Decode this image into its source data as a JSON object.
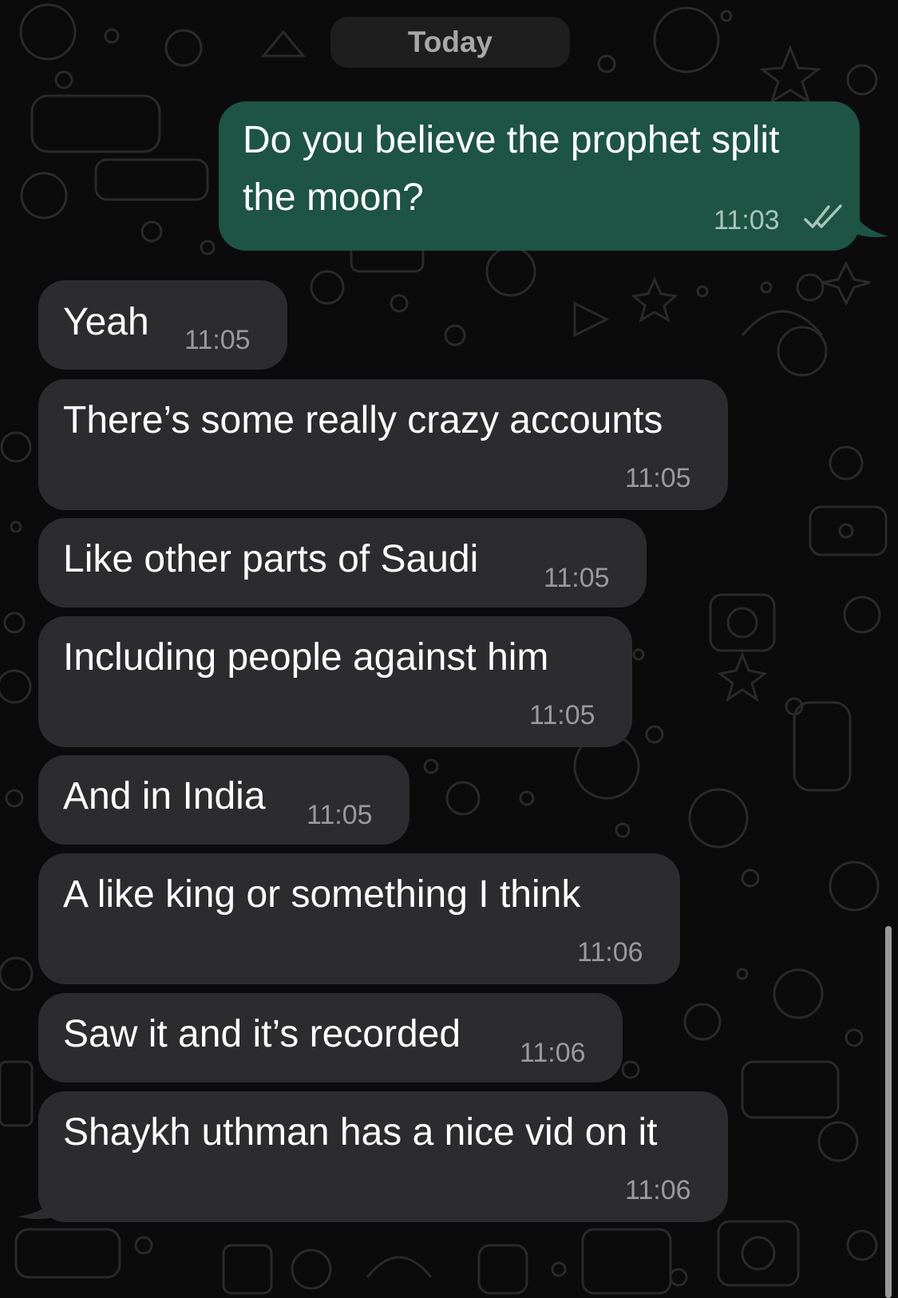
{
  "chat": {
    "date_header": "Today",
    "messages": [
      {
        "direction": "outgoing",
        "lines": [
          "Do you believe the prophet split",
          "the moon?"
        ],
        "time": "11:03",
        "status": "read"
      },
      {
        "direction": "incoming",
        "text": "Yeah",
        "time": "11:05"
      },
      {
        "direction": "incoming",
        "text": "There’s some really crazy accounts",
        "time": "11:05"
      },
      {
        "direction": "incoming",
        "text": "Like other parts of Saudi",
        "time": "11:05"
      },
      {
        "direction": "incoming",
        "text": "Including people against him",
        "time": "11:05"
      },
      {
        "direction": "incoming",
        "text": "And in India",
        "time": "11:05"
      },
      {
        "direction": "incoming",
        "text": "A like king or something I think",
        "time": "11:06"
      },
      {
        "direction": "incoming",
        "text": "Saw it and it’s recorded",
        "time": "11:06"
      },
      {
        "direction": "incoming",
        "text": "Shaykh uthman has a nice vid on it",
        "time": "11:06"
      }
    ]
  },
  "icons": [
    "double-check-icon",
    "wallpaper-doodle-pattern"
  ],
  "colors": {
    "background": "#0b0b0b",
    "incoming_bubble": "#2c2c2e",
    "outgoing_bubble": "#1d5443",
    "timestamp": "#9a9a9c",
    "date_chip": "#1e1e1e"
  }
}
